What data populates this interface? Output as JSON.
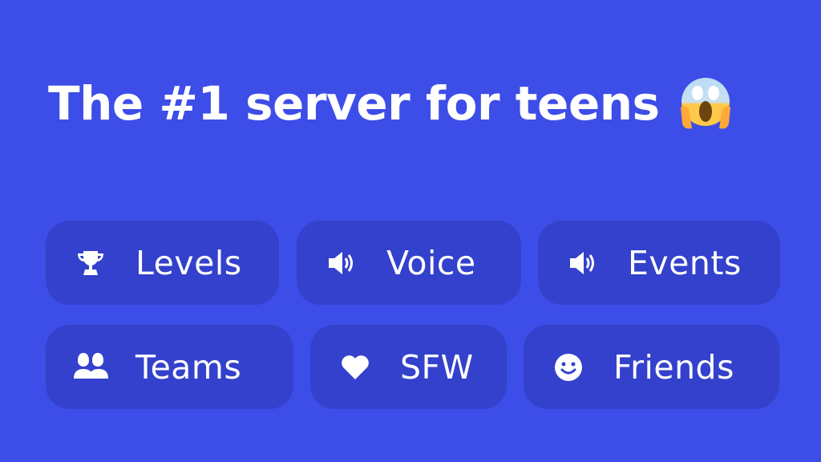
{
  "headline": "The #1 server for teens",
  "emoji": "face-screaming-in-fear",
  "colors": {
    "background": "#3d4de8",
    "pill": "#3341cc",
    "text": "#ffffff"
  },
  "features": [
    {
      "label": "Levels",
      "icon": "trophy-icon"
    },
    {
      "label": "Voice",
      "icon": "speaker-icon"
    },
    {
      "label": "Events",
      "icon": "speaker-icon"
    },
    {
      "label": "Teams",
      "icon": "users-icon"
    },
    {
      "label": "SFW",
      "icon": "heart-icon"
    },
    {
      "label": "Friends",
      "icon": "smile-icon"
    }
  ]
}
